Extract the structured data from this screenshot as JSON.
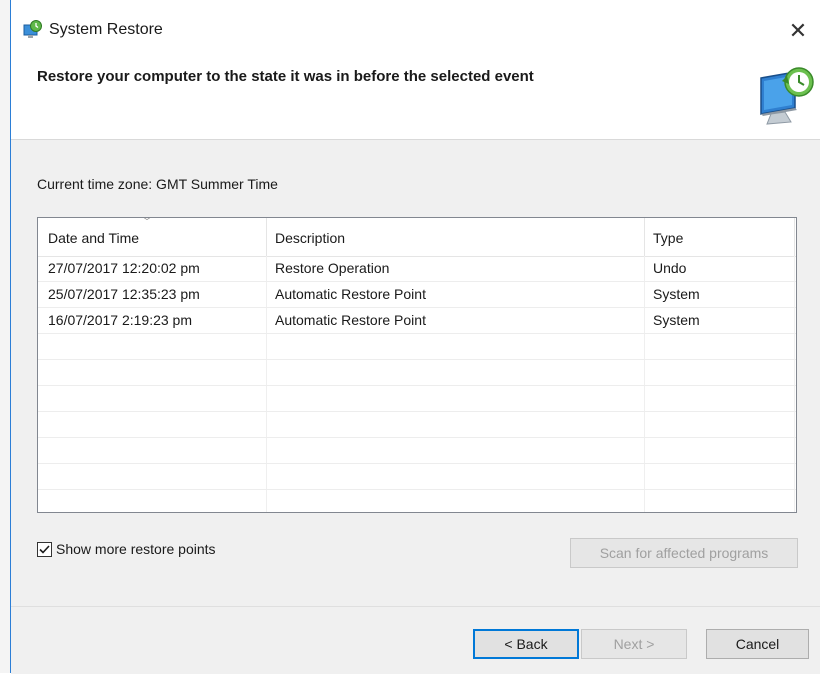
{
  "window": {
    "title": "System Restore",
    "close_glyph": "✕"
  },
  "header": {
    "heading": "Restore your computer to the state it was in before the selected event"
  },
  "timezone": {
    "text": "Current time zone: GMT Summer Time"
  },
  "table": {
    "columns": [
      "Date and Time",
      "Description",
      "Type"
    ],
    "sort_indicator": "﹀",
    "rows": [
      {
        "date": "27/07/2017 12:20:02 pm",
        "description": "Restore Operation",
        "type": "Undo"
      },
      {
        "date": "25/07/2017 12:35:23 pm",
        "description": "Automatic Restore Point",
        "type": "System"
      },
      {
        "date": "16/07/2017 2:19:23 pm",
        "description": "Automatic Restore Point",
        "type": "System"
      },
      {
        "date": "",
        "description": "",
        "type": ""
      },
      {
        "date": "",
        "description": "",
        "type": ""
      },
      {
        "date": "",
        "description": "",
        "type": ""
      },
      {
        "date": "",
        "description": "",
        "type": ""
      },
      {
        "date": "",
        "description": "",
        "type": ""
      },
      {
        "date": "",
        "description": "",
        "type": ""
      },
      {
        "date": "",
        "description": "",
        "type": ""
      }
    ]
  },
  "options": {
    "show_more_label": "Show more restore points",
    "show_more_checked": true
  },
  "buttons": {
    "scan": "Scan for affected programs",
    "back": "< Back",
    "next": "Next >",
    "cancel": "Cancel"
  },
  "colors": {
    "accent": "#0078d7",
    "body_bg": "#f0f0f0",
    "disabled_text": "#a0a0a0"
  },
  "icons": {
    "app": "system-restore-icon",
    "header": "system-restore-large-icon",
    "close": "close-icon",
    "check": "checkmark-icon"
  }
}
